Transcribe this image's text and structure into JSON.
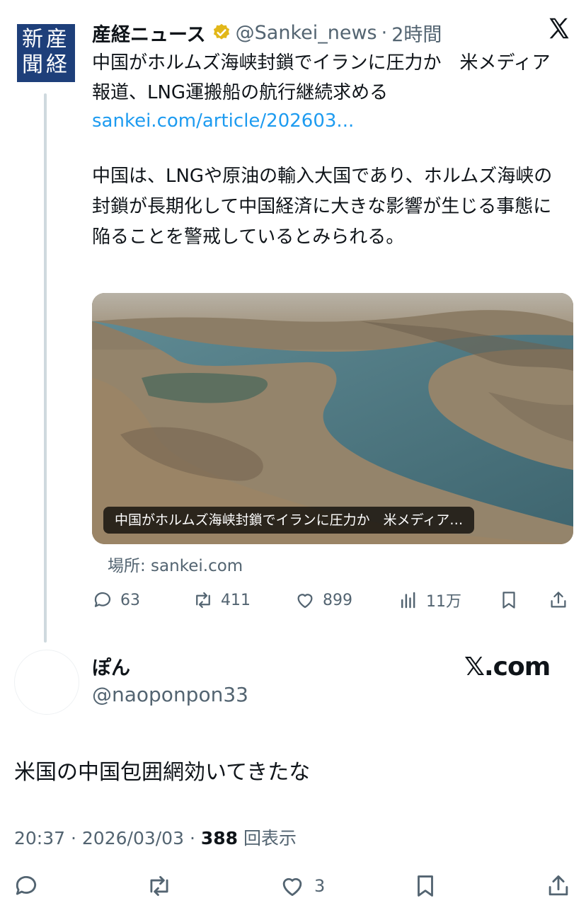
{
  "quoted": {
    "logo_text_1": "新産",
    "logo_text_2": "聞経",
    "name": "産経ニュース",
    "handle": "@Sankei_news",
    "separator": "·",
    "time": "2時間",
    "title": "中国がホルムズ海峡封鎖でイランに圧力か　米メディア報道、LNG運搬船の航行継続求める",
    "link": "sankei.com/article/202603...",
    "body": "中国は、LNGや原油の輸入大国であり、ホルムズ海峡の封鎖が長期化して中国経済に大きな影響が生じる事態に陥ることを警戒しているとみられる。",
    "card_caption": "中国がホルムズ海峡封鎖でイランに圧力か　米メディア…",
    "card_source": "場所: sankei.com",
    "actions": {
      "replies": "63",
      "reposts": "411",
      "likes": "899",
      "views": "11万"
    }
  },
  "reply": {
    "name": "ぽん",
    "handle": "@naoponpon33",
    "source_label": "𝕏.com",
    "text": "米国の中国包囲網効いてきたな",
    "time": "20:37",
    "date": "2026/03/03",
    "views_count": "388",
    "views_label": "回表示",
    "likes": "3"
  },
  "colors": {
    "text": "#0f1419",
    "secondary": "#536471",
    "link": "#1d9bf0",
    "logo_bg": "#1e3f7a",
    "badge": "#e2b719"
  }
}
